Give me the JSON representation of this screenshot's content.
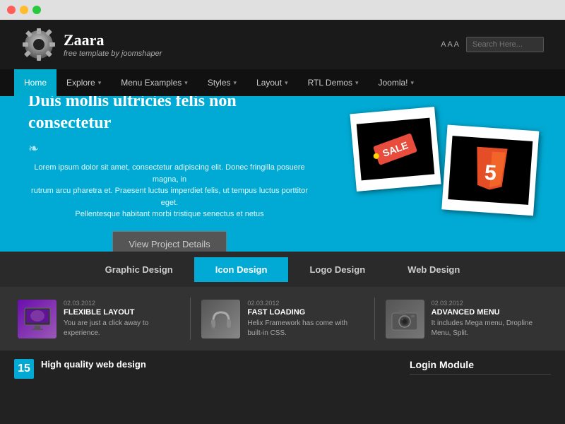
{
  "browser": {
    "dots": [
      "red",
      "yellow",
      "green"
    ]
  },
  "header": {
    "logo_title": "Zaara",
    "logo_subtitle": "free template by joomshaper",
    "search_placeholder": "Search Here...",
    "icons_text": "A  A  A"
  },
  "navbar": {
    "items": [
      {
        "label": "Home",
        "active": true,
        "has_arrow": false
      },
      {
        "label": "Explore",
        "active": false,
        "has_arrow": true
      },
      {
        "label": "Menu Examples",
        "active": false,
        "has_arrow": true
      },
      {
        "label": "Styles",
        "active": false,
        "has_arrow": true
      },
      {
        "label": "Layout",
        "active": false,
        "has_arrow": true
      },
      {
        "label": "RTL Demos",
        "active": false,
        "has_arrow": true
      },
      {
        "label": "Joomla!",
        "active": false,
        "has_arrow": true
      }
    ]
  },
  "hero": {
    "heading": "Duis mollis ultricies felis non consectetur",
    "divider": "❧",
    "body": "Lorem ipsum dolor sit amet, consectetur adipiscing elit. Donec fringilla posuere magna, in\nrutrum arcu pharetra et. Praesent luctus imperdiet felis, ut tempus luctus porttitor eget.\nPellentesque habitant morbi tristique senectus et netus",
    "button_label": "View Project Details",
    "polaroid1_label": "SALE",
    "polaroid2_label": "5"
  },
  "design_tabs": {
    "items": [
      {
        "label": "Graphic Design",
        "active": false
      },
      {
        "label": "Icon Design",
        "active": true
      },
      {
        "label": "Logo Design",
        "active": false
      },
      {
        "label": "Web Design",
        "active": false
      }
    ]
  },
  "features": {
    "items": [
      {
        "date": "02.03.2012",
        "title": "FLEXIBLE LAYOUT",
        "desc": "You are just a click away to experience.",
        "icon_type": "monitor"
      },
      {
        "date": "02.03.2012",
        "title": "FAST LOADING",
        "desc": "Helix Framework has come with built-in CSS.",
        "icon_type": "headphone"
      },
      {
        "date": "02.03.2012",
        "title": "ADVANCED MENU",
        "desc": "It includes Mega menu, Dropline Menu, Split.",
        "icon_type": "camera"
      }
    ]
  },
  "bottom": {
    "badge": "15",
    "heading": "High quality web design",
    "login_module_label": "Login Module"
  }
}
